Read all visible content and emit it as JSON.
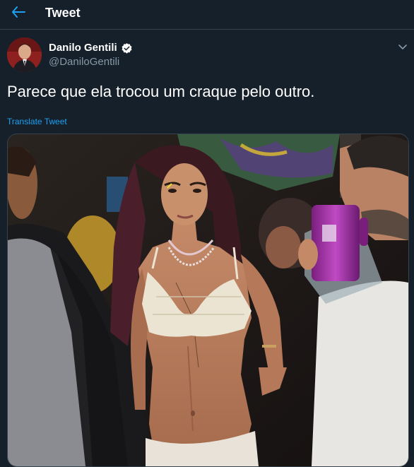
{
  "header": {
    "title": "Tweet",
    "back_icon": "arrow-left-icon"
  },
  "tweet": {
    "author": {
      "display_name": "Danilo Gentili",
      "handle": "@DaniloGentili",
      "verified_icon": "verified-badge-icon"
    },
    "text": "Parece que ela trocou um craque pelo outro.",
    "translate_label": "Translate Tweet",
    "more_icon": "chevron-down-icon",
    "media": {
      "type": "photo"
    }
  },
  "colors": {
    "background": "#15202b",
    "accent": "#1da1f2",
    "secondary_text": "#8899a6",
    "divider": "#38444d"
  }
}
